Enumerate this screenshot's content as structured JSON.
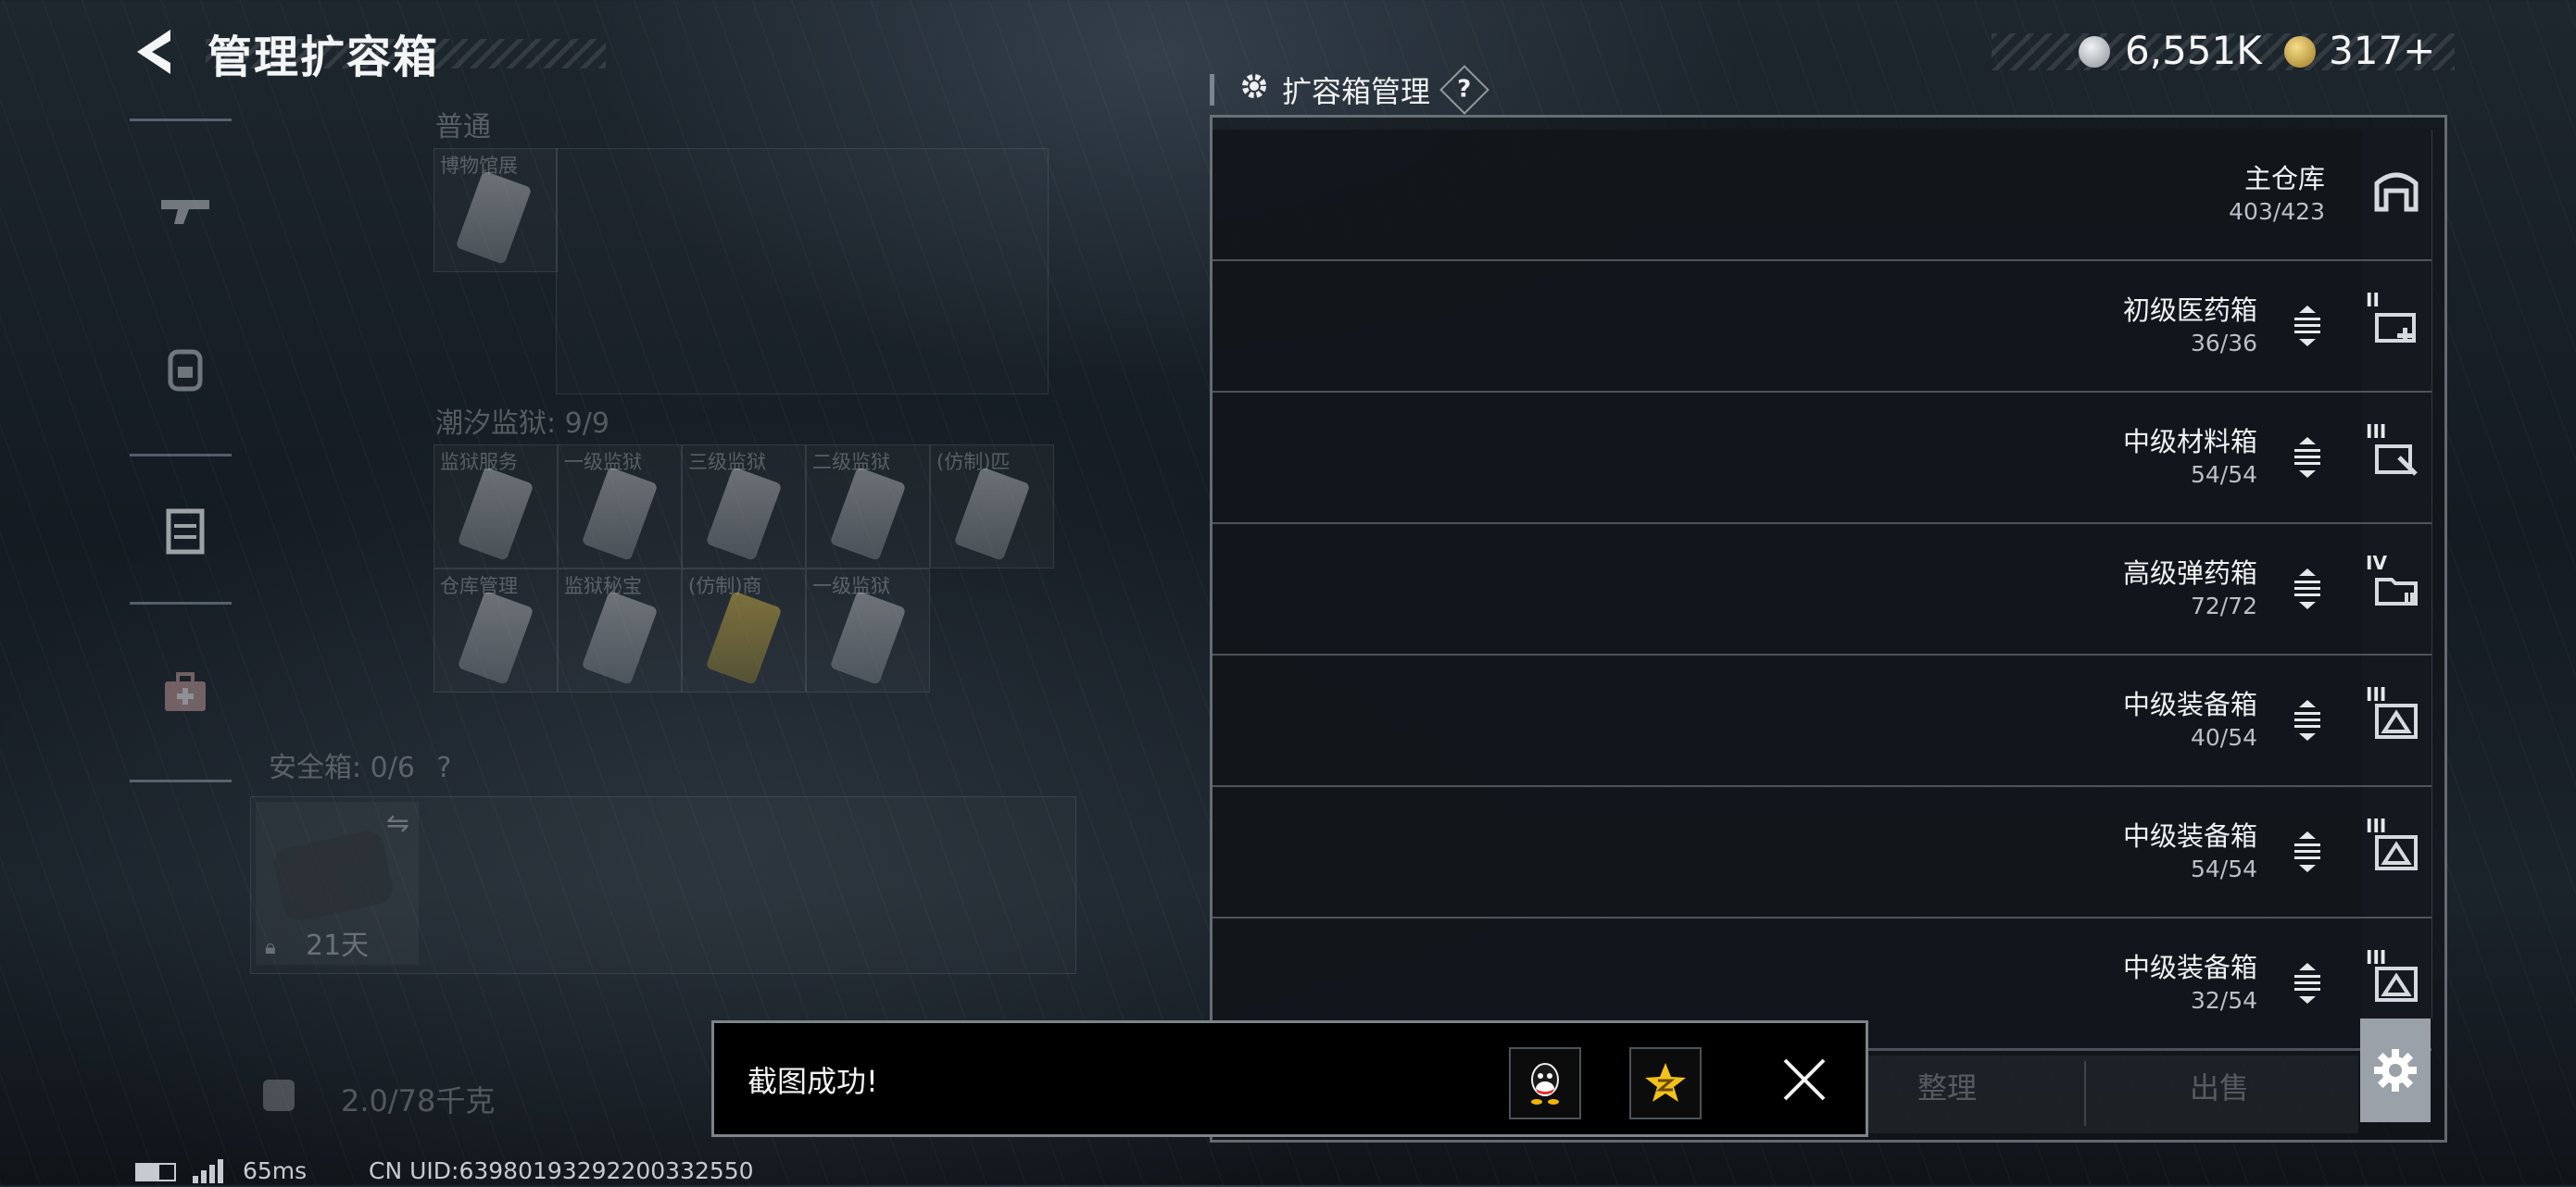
{
  "header": {
    "title": "管理扩容箱",
    "currency_silver": "6,551K",
    "currency_gold": "317+"
  },
  "backpack": {
    "hidden_section_label": "普通",
    "first_cell": "博物馆展",
    "tidal_label": "潮汐监狱: 9/9",
    "tidal_items": [
      "监狱服务",
      "一级监狱",
      "三级监狱",
      "二级监狱",
      "(仿制)匹",
      "仓库管理",
      "监狱秘宝",
      "(仿制)商",
      "一级监狱"
    ],
    "safe_box_label": "安全箱: 0/6",
    "safe_box_help": "?",
    "safe_box_timer": "21天",
    "weight": "2.0/78千克"
  },
  "panel": {
    "title": "扩容箱管理",
    "help": "?",
    "rows": [
      {
        "name": "主仓库",
        "capacity": "403/423",
        "icon": "warehouse-icon",
        "level": ""
      },
      {
        "name": "初级医药箱",
        "capacity": "36/36",
        "icon": "medical-box-icon",
        "level": "II"
      },
      {
        "name": "中级材料箱",
        "capacity": "54/54",
        "icon": "material-box-icon",
        "level": "III"
      },
      {
        "name": "高级弹药箱",
        "capacity": "72/72",
        "icon": "ammo-box-icon",
        "level": "IV"
      },
      {
        "name": "中级装备箱",
        "capacity": "40/54",
        "icon": "equipment-box-icon",
        "level": "III"
      },
      {
        "name": "中级装备箱",
        "capacity": "54/54",
        "icon": "equipment-box-icon",
        "level": "III"
      },
      {
        "name": "中级装备箱",
        "capacity": "32/54",
        "icon": "equipment-box-icon",
        "level": "III"
      }
    ],
    "organize_button": "整理",
    "sell_button": "出售"
  },
  "toast": {
    "message": "截图成功!",
    "share_qq": "qq-icon",
    "share_qzone": "qzone-icon"
  },
  "footer": {
    "ping": "65ms",
    "uid": "CN UID:63980193292200332550"
  },
  "colors": {
    "background": "#141b22",
    "panel_row": "#12161b",
    "accent_gold": "#d8b24a",
    "gear_button": "#9aa1a8"
  }
}
